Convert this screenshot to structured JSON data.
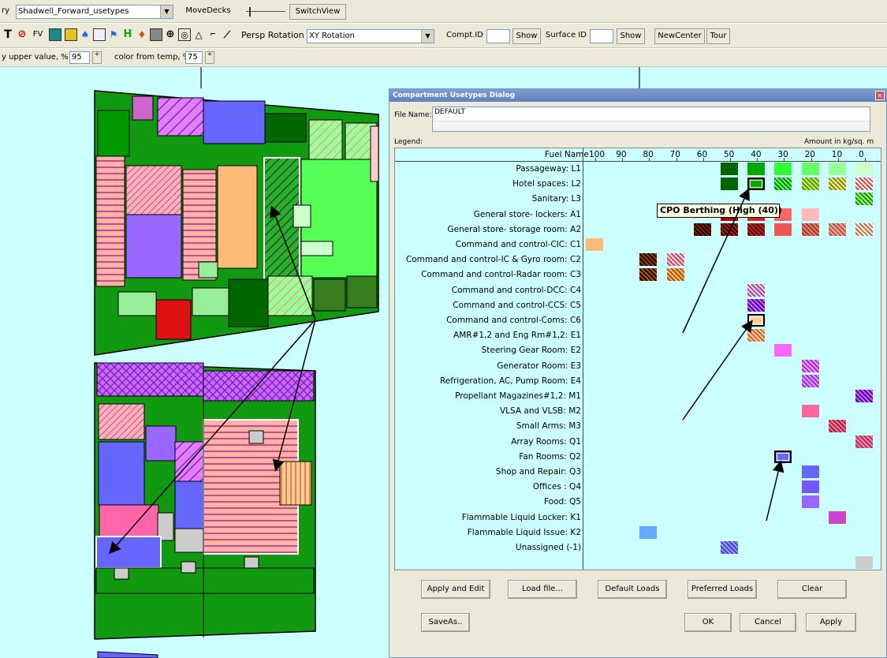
{
  "toolbar1": {
    "prefix": "ry",
    "deck_combo": "Shadwell_Forward_usetypes",
    "movedecks": "MoveDecks",
    "switchview": "SwitchView"
  },
  "toolbar2": {
    "persp_rotation_label": "Persp Rotation",
    "rotation_combo": "XY Rotation",
    "compt_id_label": "Compt.ID",
    "show1": "Show",
    "surface_id_label": "Surface ID",
    "show2": "Show",
    "newcenter": "NewCenter",
    "tour": "Tour",
    "icon_T": "T",
    "icon_FV": "FV",
    "icon_H": "H"
  },
  "toolbar3": {
    "upper_label": "y upper value, %",
    "upper_value": "95",
    "temp_label": "color from temp, %",
    "temp_value": "75"
  },
  "dialog": {
    "title": "Compartment Usetypes Dialog",
    "file_name_label": "File Name:",
    "file_name_value": "DEFAULT",
    "legend_label": "Legend:",
    "amount_label": "Amount in kg/sq. m",
    "column_header": "Fuel Name",
    "axis_ticks": [
      "100",
      "90",
      "80",
      "70",
      "60",
      "50",
      "40",
      "30",
      "20",
      "10",
      "0"
    ],
    "rows": [
      "Passageway: L1",
      "Hotel spaces: L2",
      "Sanitary: L3",
      "General store- lockers: A1",
      "General store- storage room: A2",
      "Command and control-CIC: C1",
      "Command and control-IC & Gyro room: C2",
      "Command and control-Radar room: C3",
      "Command and control-DCC: C4",
      "Command and control-CCS: C5",
      "Command and control-Coms: C6",
      "AMR#1,2 and Eng Rm#1,2: E1",
      "Steering Gear Room: E2",
      "Generator Room: E3",
      "Refrigeration, AC, Pump Room: E4",
      "Propellant Magazines#1,2: M1",
      "VLSA and VLSB: M2",
      "Small Arms: M3",
      "Array Rooms: Q1",
      "Fan Rooms: Q2",
      "Shop and Repair: Q3",
      "Offices : Q4",
      "Food: Q5",
      "Flammable Liquid Locker: K1",
      "Flammable Liquid Issue: K2",
      "Unassigned (-1)"
    ],
    "tooltip": "CPO Berthing (High (40))",
    "buttons": {
      "apply_and_edit": "Apply and Edit",
      "load_file": "Load file...",
      "default_loads": "Default Loads",
      "preferred_loads": "Preferred Loads",
      "clear": "Clear",
      "saveas": "SaveAs..",
      "ok": "OK",
      "cancel": "Cancel",
      "apply": "Apply"
    }
  },
  "colors": {
    "canvas_bg": "#ccffff",
    "dialog_bg": "#ece9d8",
    "title_bar": "#6a8cc8",
    "dark_green": "#006600",
    "green": "#00cc00",
    "light_green": "#66ff66",
    "pink": "#ff9999",
    "purple": "#9966ff",
    "blue": "#6666ff"
  }
}
